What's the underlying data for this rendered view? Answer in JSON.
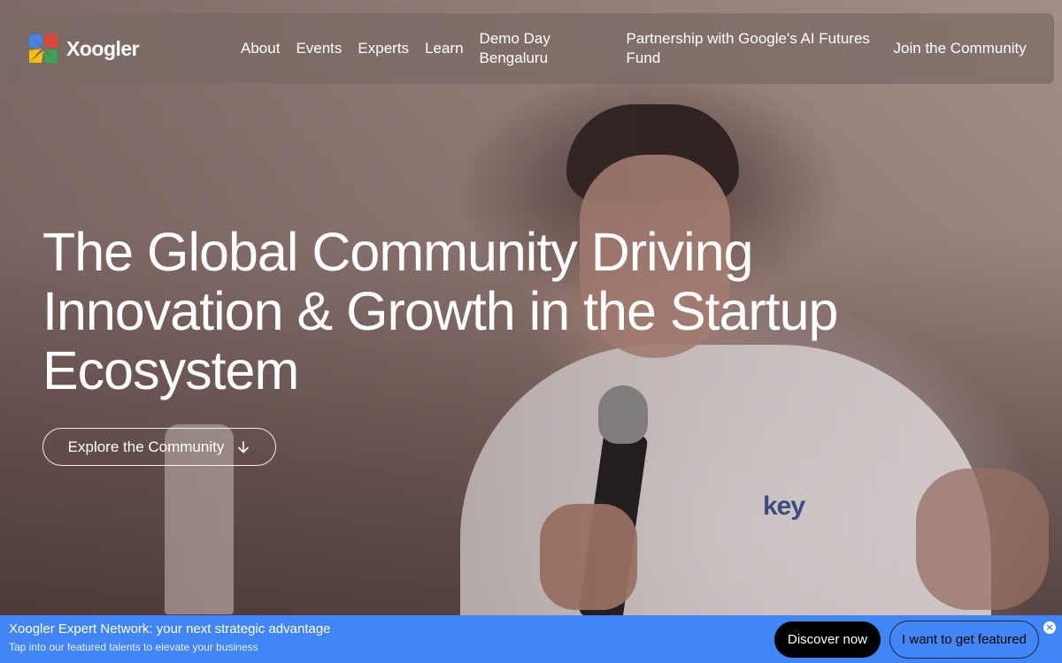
{
  "nav": {
    "brand": "Xoogler",
    "links": [
      {
        "label": "About"
      },
      {
        "label": "Events"
      },
      {
        "label": "Experts"
      },
      {
        "label": "Learn"
      },
      {
        "label": "Demo Day Bengaluru"
      },
      {
        "label": "Partnership with Google's AI Futures Fund"
      },
      {
        "label": "Join the Community"
      }
    ]
  },
  "hero": {
    "title": "The Global Community Driving Innovation & Growth in the Startup Ecosystem",
    "cta_label": "Explore the Community",
    "cta_icon": "arrow-down-icon",
    "shirt_text": "key"
  },
  "banner": {
    "title": "Xoogler Expert Network: your next strategic advantage",
    "subtitle": "Tap into our featured talents to elevate your business",
    "primary_label": "Discover now",
    "secondary_label": "I want to get featured",
    "close_symbol": "×"
  },
  "colors": {
    "banner_bg": "#4285f4",
    "primary_btn_bg": "#000000",
    "text_on_hero": "#ffffff",
    "logo_blue": "#4285f4",
    "logo_red": "#ea4335",
    "logo_yellow": "#fbbc05",
    "logo_green": "#34a853"
  }
}
